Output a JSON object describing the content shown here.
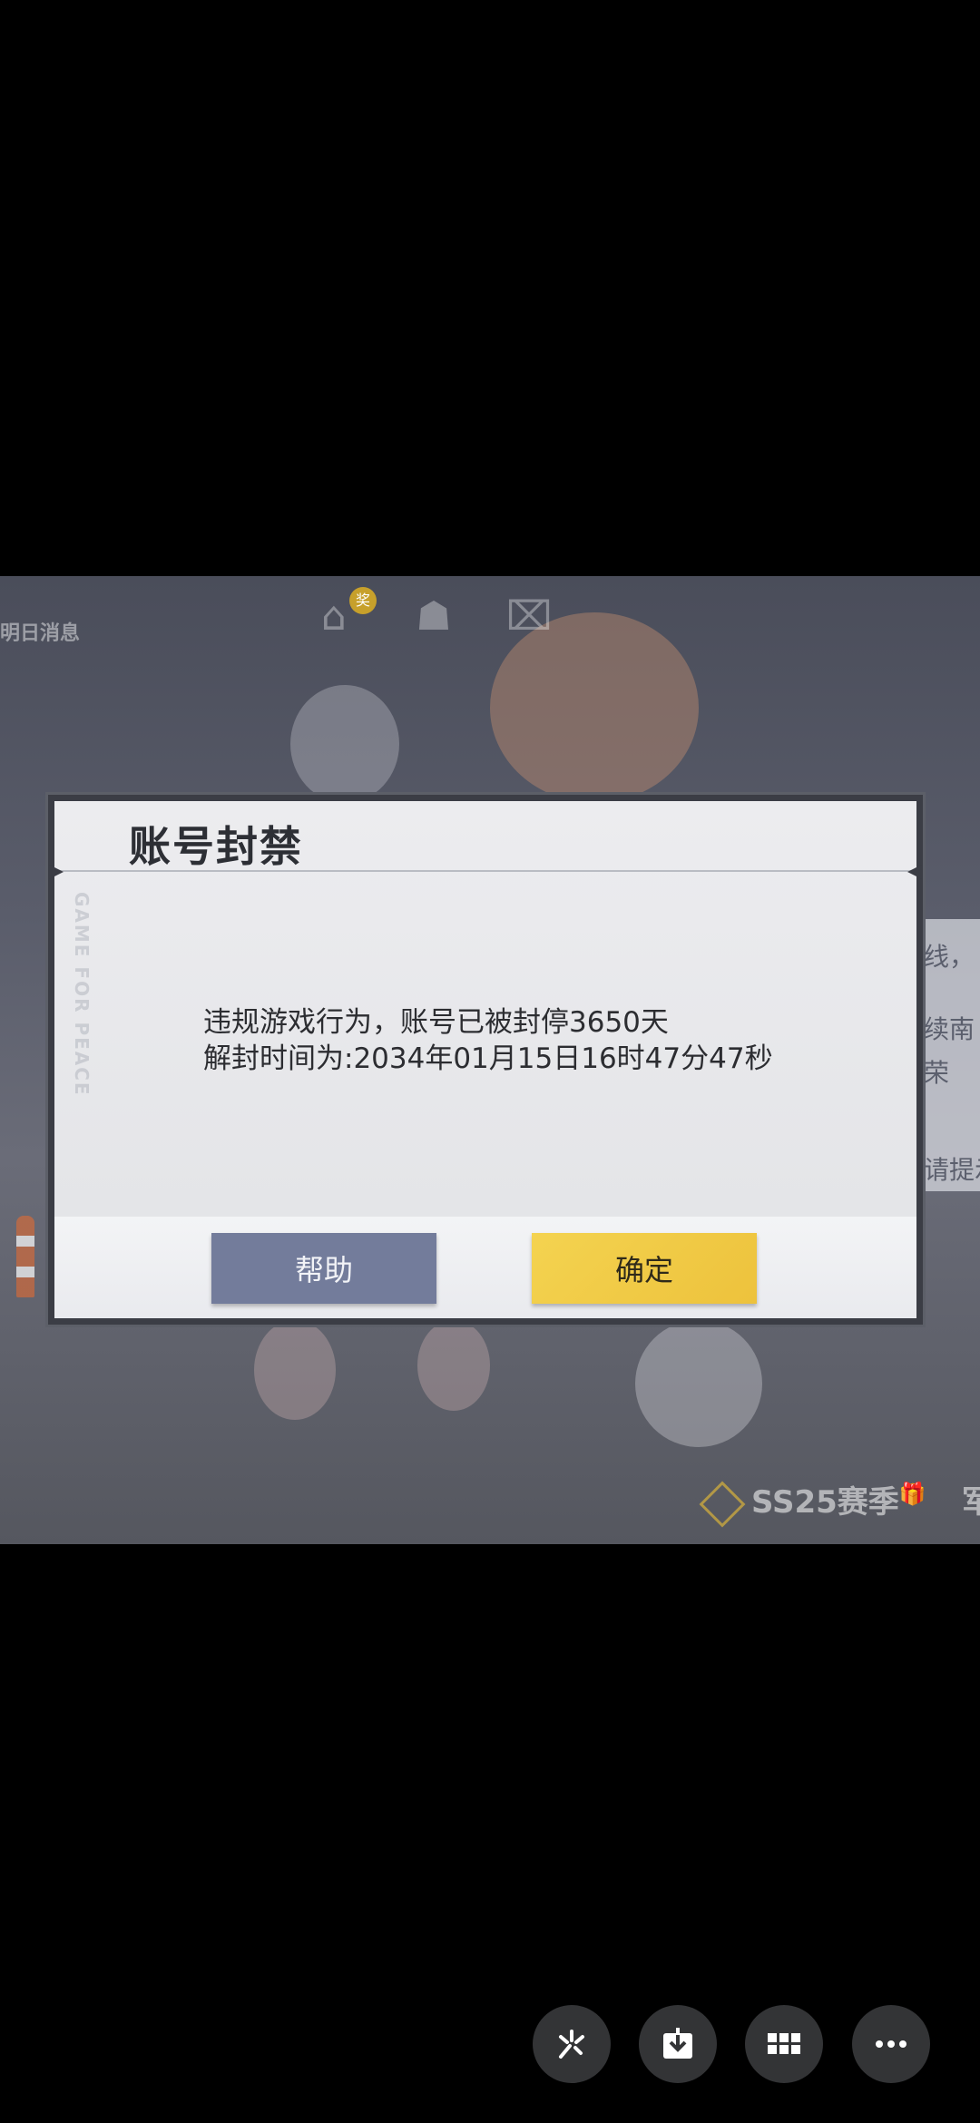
{
  "game": {
    "top_nav_label": "明日消息",
    "nav_badge": "奖",
    "side_panel": [
      "线，",
      "续南",
      "荣",
      "请提示"
    ],
    "season_label": "SS25赛季",
    "season_extra": "军"
  },
  "dialog": {
    "title": "账号封禁",
    "watermark": "GAME FOR PEACE",
    "message_line1": "违规游戏行为，账号已被封停3650天",
    "message_line2": "解封时间为:2034年01月15日16时47分47秒",
    "help_label": "帮助",
    "confirm_label": "确定"
  },
  "toolbar": {
    "buttons": [
      "magic-icon",
      "download-icon",
      "grid-icon",
      "more-icon"
    ]
  },
  "colors": {
    "confirm_button": "#edc23c",
    "help_button": "#737c9b",
    "dialog_bg": "#e6e7ea"
  }
}
